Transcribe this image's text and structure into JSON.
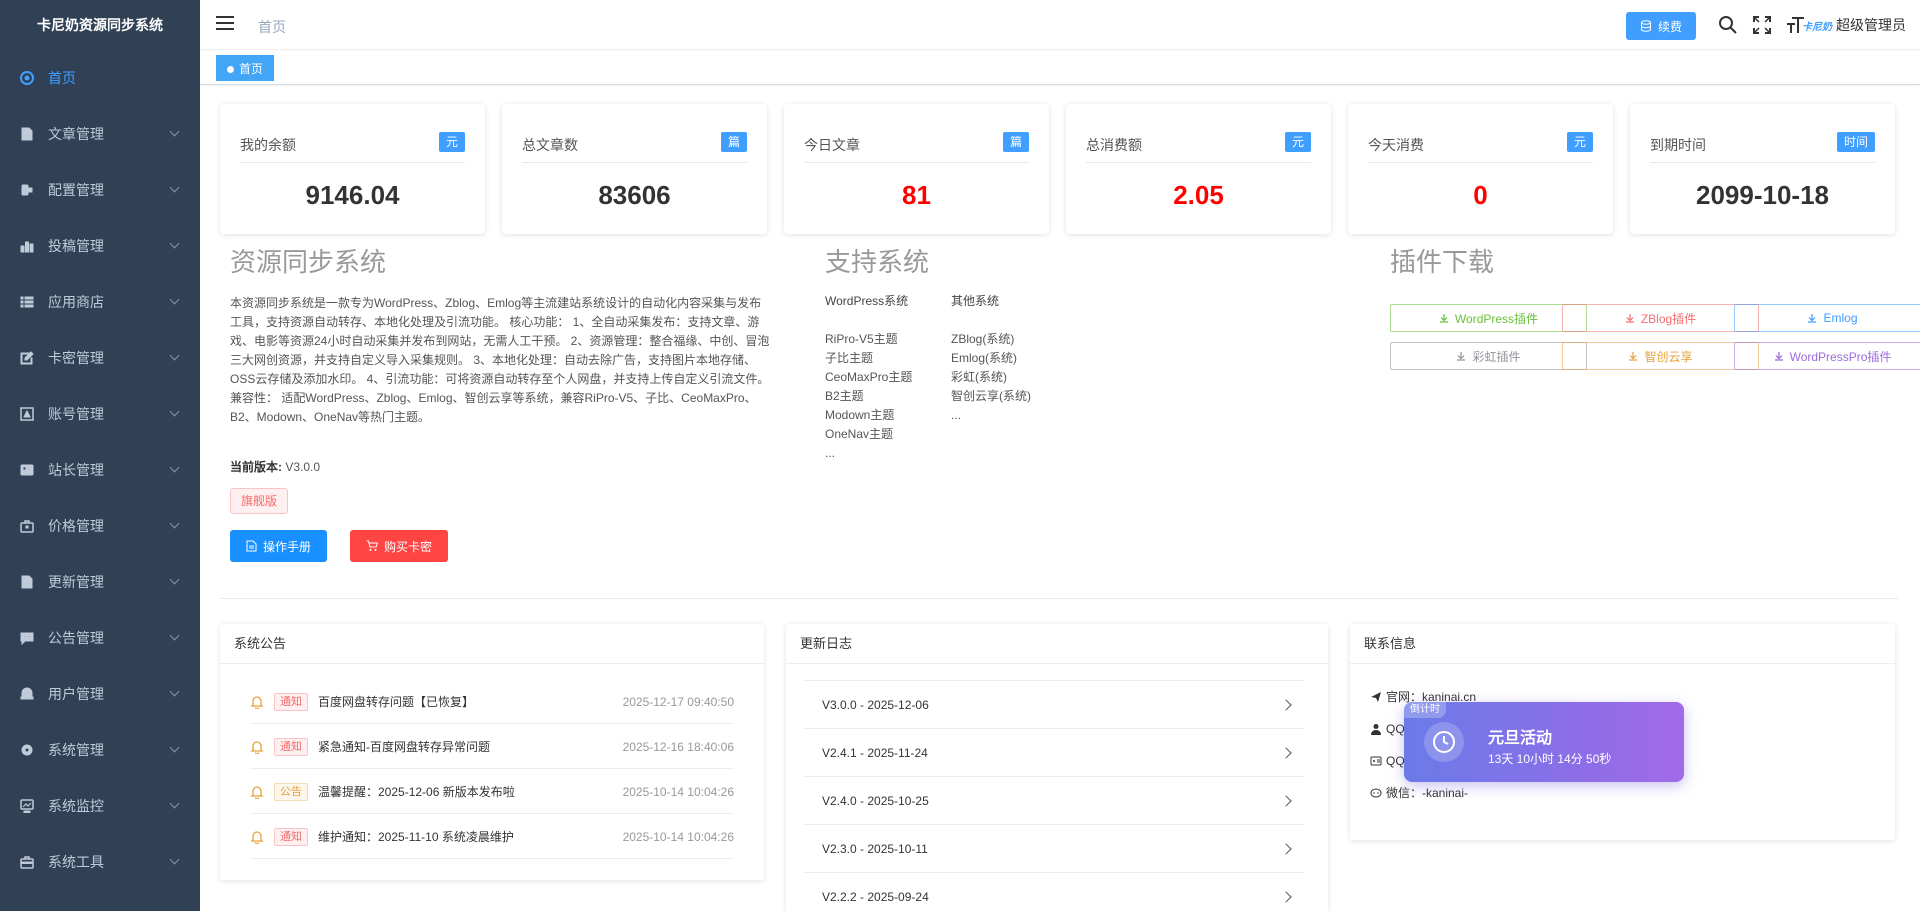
{
  "app": {
    "title": "卡尼奶资源同步系统"
  },
  "sidebar": {
    "items": [
      {
        "label": "首页",
        "icon": "dashboard-icon",
        "active": true,
        "expandable": false
      },
      {
        "label": "文章管理",
        "icon": "document-icon",
        "expandable": true
      },
      {
        "label": "配置管理",
        "icon": "config-icon",
        "expandable": true
      },
      {
        "label": "投稿管理",
        "icon": "bar-chart-icon",
        "expandable": true
      },
      {
        "label": "应用商店",
        "icon": "list-icon",
        "expandable": true
      },
      {
        "label": "卡密管理",
        "icon": "edit-icon",
        "expandable": true
      },
      {
        "label": "账号管理",
        "icon": "account-icon",
        "expandable": true
      },
      {
        "label": "站长管理",
        "icon": "webmaster-icon",
        "expandable": true
      },
      {
        "label": "价格管理",
        "icon": "price-icon",
        "expandable": true
      },
      {
        "label": "更新管理",
        "icon": "update-icon",
        "expandable": true
      },
      {
        "label": "公告管理",
        "icon": "message-icon",
        "expandable": true
      },
      {
        "label": "用户管理",
        "icon": "user-icon",
        "expandable": true
      },
      {
        "label": "系统管理",
        "icon": "gear-icon",
        "expandable": true
      },
      {
        "label": "系统监控",
        "icon": "monitor-icon",
        "expandable": true
      },
      {
        "label": "系统工具",
        "icon": "toolbox-icon",
        "expandable": true
      }
    ]
  },
  "header": {
    "breadcrumb": "首页",
    "renew_label": "续费",
    "user_logo": "卡尼奶",
    "user_name": "超级管理员"
  },
  "tags": {
    "active": "首页"
  },
  "stats": [
    {
      "title": "我的余额",
      "badge": "元",
      "value": "9146.04",
      "red": false
    },
    {
      "title": "总文章数",
      "badge": "篇",
      "value": "83606",
      "red": false
    },
    {
      "title": "今日文章",
      "badge": "篇",
      "value": "81",
      "red": true
    },
    {
      "title": "总消费额",
      "badge": "元",
      "value": "2.05",
      "red": true
    },
    {
      "title": "今天消费",
      "badge": "元",
      "value": "0",
      "red": true
    },
    {
      "title": "到期时间",
      "badge": "时间",
      "value": "2099-10-18",
      "red": false
    }
  ],
  "intro": {
    "title": "资源同步系统",
    "text": "本资源同步系统是一款专为WordPress、Zblog、Emlog等主流建站系统设计的自动化内容采集与发布工具，支持资源自动转存、本地化处理及引流功能。 核心功能： 1、全自动采集发布：支持文章、游戏、电影等资源24小时自动采集并发布到网站，无需人工干预。 2、资源管理：整合福缘、中创、冒泡三大网创资源，并支持自定义导入采集规则。 3、本地化处理：自动去除广告，支持图片本地存储、OSS云存储及添加水印。 4、引流功能：可将资源自动转存至个人网盘，并支持上传自定义引流文件。 兼容性： 适配WordPress、Zblog、Emlog、智创云享等系统，兼容RiPro-V5、子比、CeoMaxPro、B2、Modown、OneNav等热门主题。",
    "version_label": "当前版本:",
    "version_value": "V3.0.0",
    "edition": "旗舰版",
    "manual_btn": "操作手册",
    "buy_btn": "购买卡密"
  },
  "support": {
    "title": "支持系统",
    "wp_head": "WordPress系统",
    "wp_items": [
      "RiPro-V5主题",
      "子比主题",
      "CeoMaxPro主题",
      "B2主题",
      "Modown主题",
      "OneNav主题",
      "..."
    ],
    "other_head": "其他系统",
    "other_items": [
      "ZBlog(系统)",
      "Emlog(系统)",
      "彩虹(系统)",
      "智创云享(系统)",
      "..."
    ]
  },
  "plugins": {
    "title": "插件下载",
    "items": [
      {
        "label": "WordPress插件",
        "color": "#67c23a"
      },
      {
        "label": "ZBlog插件",
        "color": "#f56c6c"
      },
      {
        "label": "Emlog",
        "color": "#409eff"
      },
      {
        "label": "彩虹插件",
        "color": "#909399"
      },
      {
        "label": "智创云享",
        "color": "#e6a23c"
      },
      {
        "label": "WordPressPro插件",
        "color": "#9c6ade"
      }
    ]
  },
  "notices": {
    "title": "系统公告",
    "items": [
      {
        "tag": "通知",
        "type": "notice",
        "text": "百度网盘转存问题【已恢复】",
        "time": "2025-12-17 09:40:50"
      },
      {
        "tag": "通知",
        "type": "notice",
        "text": "紧急通知-百度网盘转存异常问题",
        "time": "2025-12-16 18:40:06"
      },
      {
        "tag": "公告",
        "type": "ad",
        "text": "温馨提醒：2025-12-06 新版本发布啦",
        "time": "2025-10-14 10:04:26"
      },
      {
        "tag": "通知",
        "type": "notice",
        "text": "维护通知：2025-11-10 系统凌晨维护",
        "time": "2025-10-14 10:04:26"
      }
    ]
  },
  "changelog": {
    "title": "更新日志",
    "items": [
      "V3.0.0 - 2025-12-06",
      "V2.4.1 - 2025-11-24",
      "V2.4.0 - 2025-10-25",
      "V2.3.0 - 2025-10-11",
      "V2.2.2 - 2025-09-24"
    ]
  },
  "contact": {
    "title": "联系信息",
    "site": "官网：kaninai.cn",
    "qq_group": "QQ群：无",
    "qq": "QQ：1286677994",
    "wechat": "微信：-kaninai-"
  },
  "promo": {
    "tag": "倒计时",
    "title": "元旦活动",
    "countdown": "13天 10小时 14分 50秒"
  }
}
